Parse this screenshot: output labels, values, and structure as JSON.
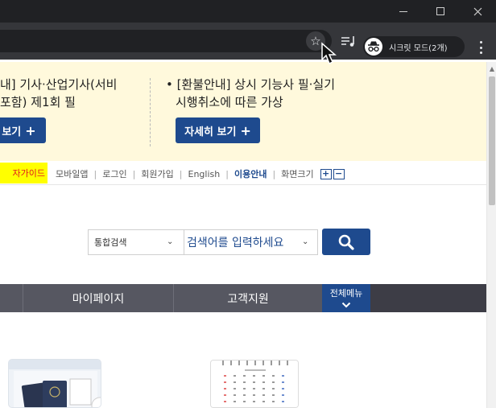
{
  "browser": {
    "incognito_label": "시크릿 모드(2개)",
    "icons": [
      "minimize-icon",
      "maximize-icon",
      "close-icon",
      "star-icon",
      "reading-list-icon",
      "incognito-icon",
      "more-menu-icon"
    ]
  },
  "notice": {
    "left_line1": "내] 기사·산업기사(서비",
    "left_line2": "포함) 제1회 필",
    "left_button": "보기",
    "right_line1": "• [환불안내] 상시 기능사 필·실기",
    "right_line2": "시행취소에 따른 가상",
    "right_button": "자세히 보기"
  },
  "utility": {
    "guide": "자가이드",
    "links": [
      "모바일앱",
      "로그인",
      "회원가입",
      "English",
      "이용안내",
      "화면크기"
    ],
    "size_plus": "+",
    "size_minus": "−"
  },
  "search": {
    "category": "통합검색",
    "placeholder": "검색어를 입력하세요"
  },
  "nav": {
    "items": [
      "마이페이지",
      "고객지원"
    ],
    "all_menu": "전체메뉴"
  },
  "colors": {
    "brand_blue": "#1e4a8e",
    "notice_bg": "#fff9dc",
    "nav_bg": "#565761",
    "guide_highlight": "#ffff00"
  }
}
